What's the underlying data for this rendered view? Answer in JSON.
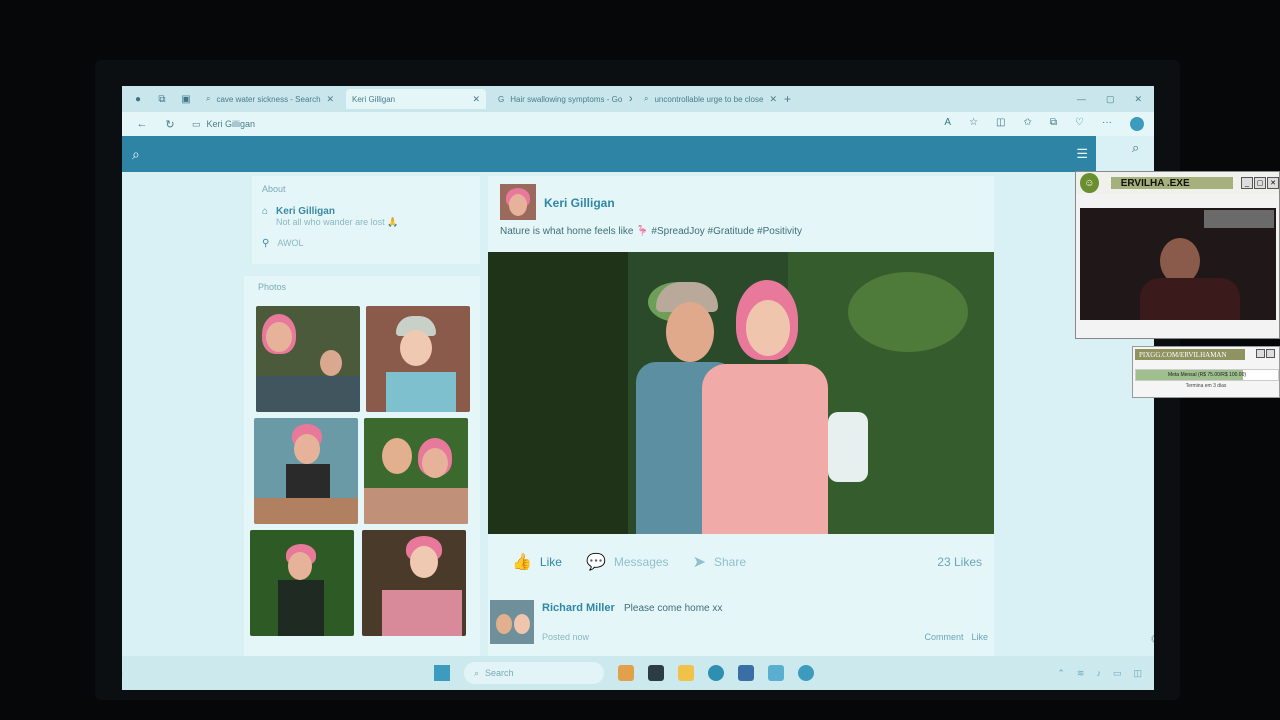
{
  "browser": {
    "tabs": [
      {
        "label": "cave water sickness - Search",
        "active": false
      },
      {
        "label": "Keri Gilligan",
        "active": true
      },
      {
        "label": "Hair swallowing symptoms - Go",
        "active": false
      },
      {
        "label": "uncontrollable urge to be close",
        "active": false
      }
    ],
    "new_tab": "+",
    "address": "Keri Gilligan"
  },
  "profile": {
    "about_label": "About",
    "name": "Keri Gilligan",
    "bio": "Not all who wander are lost 🙏",
    "location": "AWOL",
    "photos_label": "Photos"
  },
  "post": {
    "author": "Keri Gilligan",
    "text": "Nature is what home feels like 🦩 #SpreadJoy #Gratitude #Positivity",
    "like_label": "Like",
    "messages_label": "Messages",
    "share_label": "Share",
    "likes_count": "23 Likes"
  },
  "comment": {
    "author": "Richard Miller",
    "text": "Please come home xx",
    "time": "Posted now",
    "comment_link": "Comment",
    "like_link": "Like"
  },
  "taskbar": {
    "search_placeholder": "Search"
  },
  "overlay": {
    "cam_title": "ERVILHA .EXE",
    "donation_title": "PIXGG.COM/ERVILHAMAN",
    "donation_goal": "Meta Mensal (R$ 75.00/R$ 100.00)",
    "donation_progress": 0.75,
    "donation_sub": "Termina em 3 dias"
  }
}
